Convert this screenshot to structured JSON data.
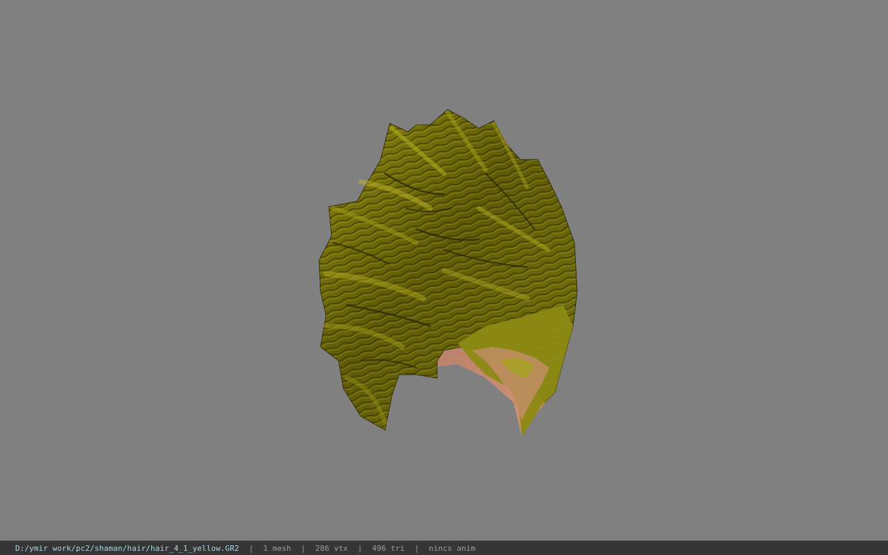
{
  "viewport": {
    "background_color": "#808080",
    "model_name": "hair-mesh",
    "model_colors": {
      "hair_dark": "#3a3a05",
      "hair_mid": "#6b6b0a",
      "hair_light": "#a6a017",
      "skin": "#c98e70"
    }
  },
  "status_bar": {
    "file_path": "D:/ymir work/pc2/shaman/hair/hair_4_1_yellow.GR2",
    "separator": "|",
    "mesh_count": "1 mesh",
    "vertex_count": "286 vtx",
    "triangle_count": "496 tri",
    "anim_info": "nincs anim"
  }
}
